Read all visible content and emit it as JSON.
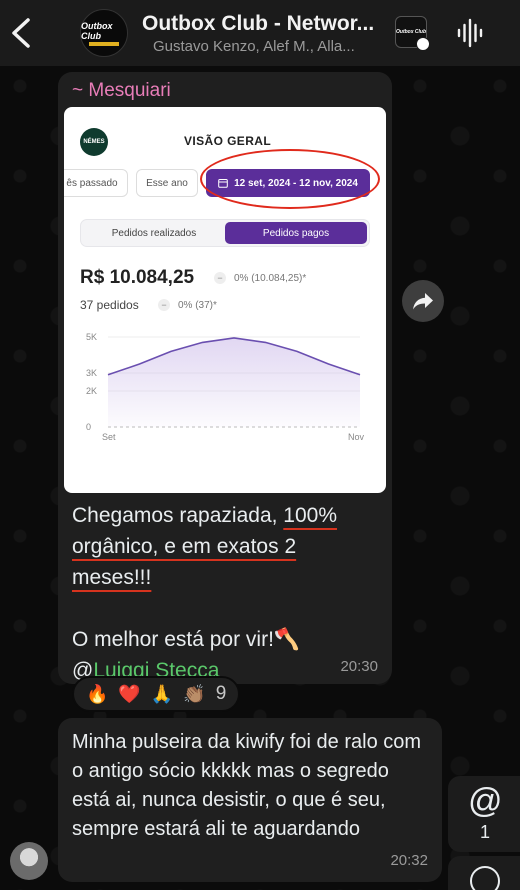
{
  "header": {
    "title": "Outbox Club - Networ...",
    "subtitle": "Gustavo Kenzo, Alef M., Alla...",
    "avatar_logo": "Outbox Club",
    "icons": {
      "back": "chevron-left-icon",
      "audio": "audio-waveform-icon"
    }
  },
  "messages": [
    {
      "sender": "~ Mesquiari",
      "screenshot": {
        "logo": "NÉMES",
        "title": "VISÃO GERAL",
        "filters": [
          "ês passado",
          "Esse ano",
          "12 set, 2024 - 12 nov, 2024"
        ],
        "tabs": [
          "Pedidos realizados",
          "Pedidos pagos"
        ],
        "active_tab": "Pedidos pagos",
        "revenue": "R$ 10.084,25",
        "revenue_change": "0% (10.084,25)*",
        "orders": "37 pedidos",
        "orders_change": "0% (37)*"
      },
      "text_parts": {
        "line_a": "Chegamos rapaziada, ",
        "u1": "100%",
        "u2": "orgânico, e em exatos 2",
        "u3": "meses!!!",
        "line_b": "O melhor está por vir!🪓",
        "at": "@",
        "mention": "Luiggi Stecca"
      },
      "time": "20:30",
      "reactions": [
        "🔥",
        "❤️",
        "🙏",
        "👏🏽"
      ],
      "reaction_count": "9"
    },
    {
      "text": "Minha pulseira da kiwify foi de ralo com o antigo sócio kkkkk mas o segredo está ai, nunca desistir, o que é seu, sempre estará ali te aguardando",
      "time": "20:32"
    }
  ],
  "mention_button": {
    "symbol": "@",
    "count": "1"
  },
  "chart_data": {
    "type": "area",
    "x": [
      "Set",
      "Nov"
    ],
    "xlabels": [
      "Set",
      "Nov"
    ],
    "yticks": [
      "0",
      "2K",
      "3K",
      "5K"
    ],
    "ylim": [
      0,
      5000
    ],
    "series": [
      {
        "values": [
          2900,
          3500,
          4200,
          4700,
          4950,
          4700,
          4200,
          3500,
          2900
        ]
      }
    ],
    "title": "",
    "xlabel": "",
    "ylabel": ""
  },
  "colors": {
    "accent": "#5b2e9a",
    "sender": "#e87db8",
    "mention": "#5ac86a",
    "underline": "#d6331e"
  }
}
